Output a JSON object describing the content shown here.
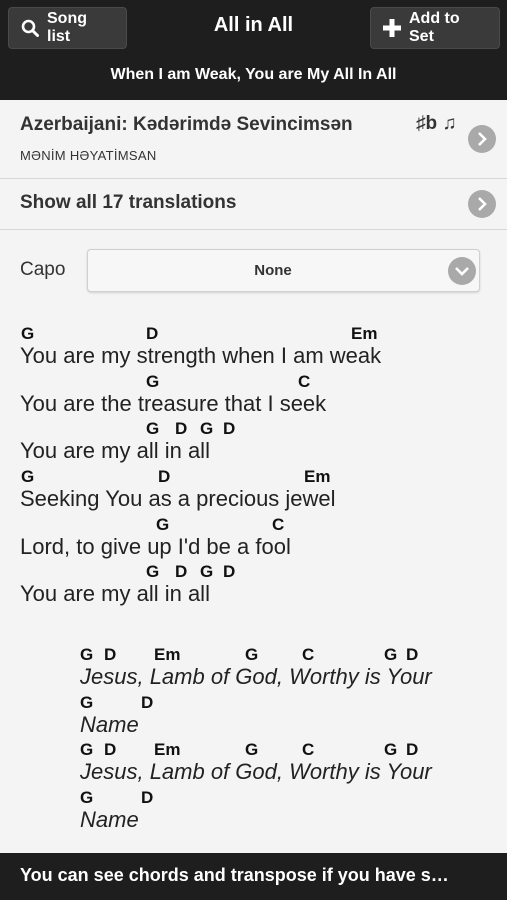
{
  "header": {
    "song_list_label": "Song list",
    "title": "All in All",
    "add_to_set_label": "Add to Set",
    "subtitle": "When I am Weak,  You are My All In All"
  },
  "translation": {
    "title": "Azerbaijani: Kədərimdə Sevincimsən",
    "subtitle": "MƏNİM HƏYATİMSAN",
    "icons": "♯b ♫"
  },
  "show_translations": {
    "label": "Show all 17 translations"
  },
  "capo": {
    "label": "Capo",
    "value": "None"
  },
  "song": {
    "lines": [
      {
        "chords": [
          "G",
          "D",
          "Em"
        ],
        "lyric": "You are my strength when I am weak"
      },
      {
        "chords": [
          "G",
          "C"
        ],
        "lyric": "You are the treasure that I seek"
      },
      {
        "chords": [
          "G",
          "D",
          "G",
          "D"
        ],
        "lyric": "You are my all in all"
      },
      {
        "chords": [
          "G",
          "D",
          "Em"
        ],
        "lyric": "Seeking You as a precious jewel"
      },
      {
        "chords": [
          "G",
          "C"
        ],
        "lyric": "Lord, to give up I'd be a fool"
      },
      {
        "chords": [
          "G",
          "D",
          "G",
          "D"
        ],
        "lyric": "You are my all in all"
      }
    ],
    "chorus": [
      {
        "chords": [
          "G",
          "D",
          "Em",
          "G",
          "C",
          "G",
          "D"
        ],
        "lyric": "Jesus, Lamb of God, Worthy is Your"
      },
      {
        "chords": [
          "G",
          "D"
        ],
        "lyric": "Name"
      },
      {
        "chords": [
          "G",
          "D",
          "Em",
          "G",
          "C",
          "G",
          "D"
        ],
        "lyric": "Jesus, Lamb of God, Worthy is Your"
      },
      {
        "chords": [
          "G",
          "D"
        ],
        "lyric": "Name"
      }
    ]
  },
  "footer": {
    "message": "You can see chords and transpose if you have s…"
  },
  "icons": [
    "search-icon",
    "plus-icon",
    "chevron-right-icon",
    "chevron-down-icon"
  ]
}
